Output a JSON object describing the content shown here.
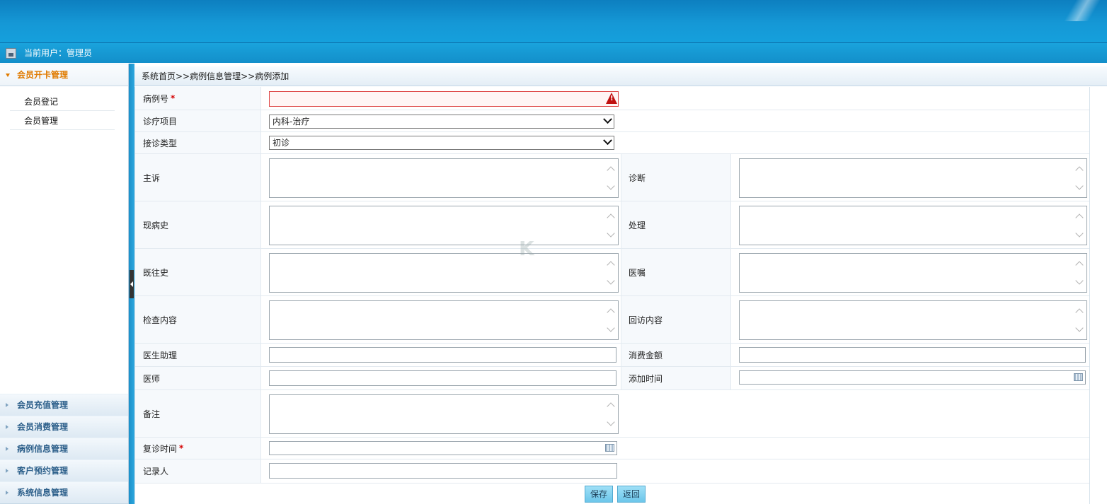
{
  "header": {
    "current_user": "当前用户：管理员"
  },
  "sidebar": {
    "active_group": {
      "label": "会员开卡管理",
      "items": [
        "会员登记",
        "会员管理"
      ]
    },
    "groups": [
      "会员充值管理",
      "会员消费管理",
      "病例信息管理",
      "客户预约管理",
      "系统信息管理"
    ]
  },
  "breadcrumb": "系统首页>>病例信息管理>>病例添加",
  "form": {
    "case_no": {
      "label": "病例号",
      "required": "*",
      "value": ""
    },
    "treatment_item": {
      "label": "诊疗项目",
      "value": "内科-治疗"
    },
    "visit_type": {
      "label": "接诊类型",
      "value": "初诊"
    },
    "chief_complaint": {
      "label": "主诉"
    },
    "diagnosis": {
      "label": "诊断"
    },
    "present_illness": {
      "label": "现病史"
    },
    "treatment": {
      "label": "处理"
    },
    "past_history": {
      "label": "既往史"
    },
    "medical_advice": {
      "label": "医嘱"
    },
    "exam_content": {
      "label": "检查内容"
    },
    "followup_content": {
      "label": "回访内容"
    },
    "doctor_assistant": {
      "label": "医生助理",
      "value": ""
    },
    "amount": {
      "label": "消费金额",
      "value": ""
    },
    "doctor": {
      "label": "医师",
      "value": ""
    },
    "add_time": {
      "label": "添加时间",
      "value": ""
    },
    "remark": {
      "label": "备注"
    },
    "revisit_time": {
      "label": "复诊时间",
      "required": "*",
      "value": ""
    },
    "recorder": {
      "label": "记录人",
      "value": ""
    }
  },
  "buttons": {
    "save": "保存",
    "back": "返回"
  },
  "watermark": "K"
}
